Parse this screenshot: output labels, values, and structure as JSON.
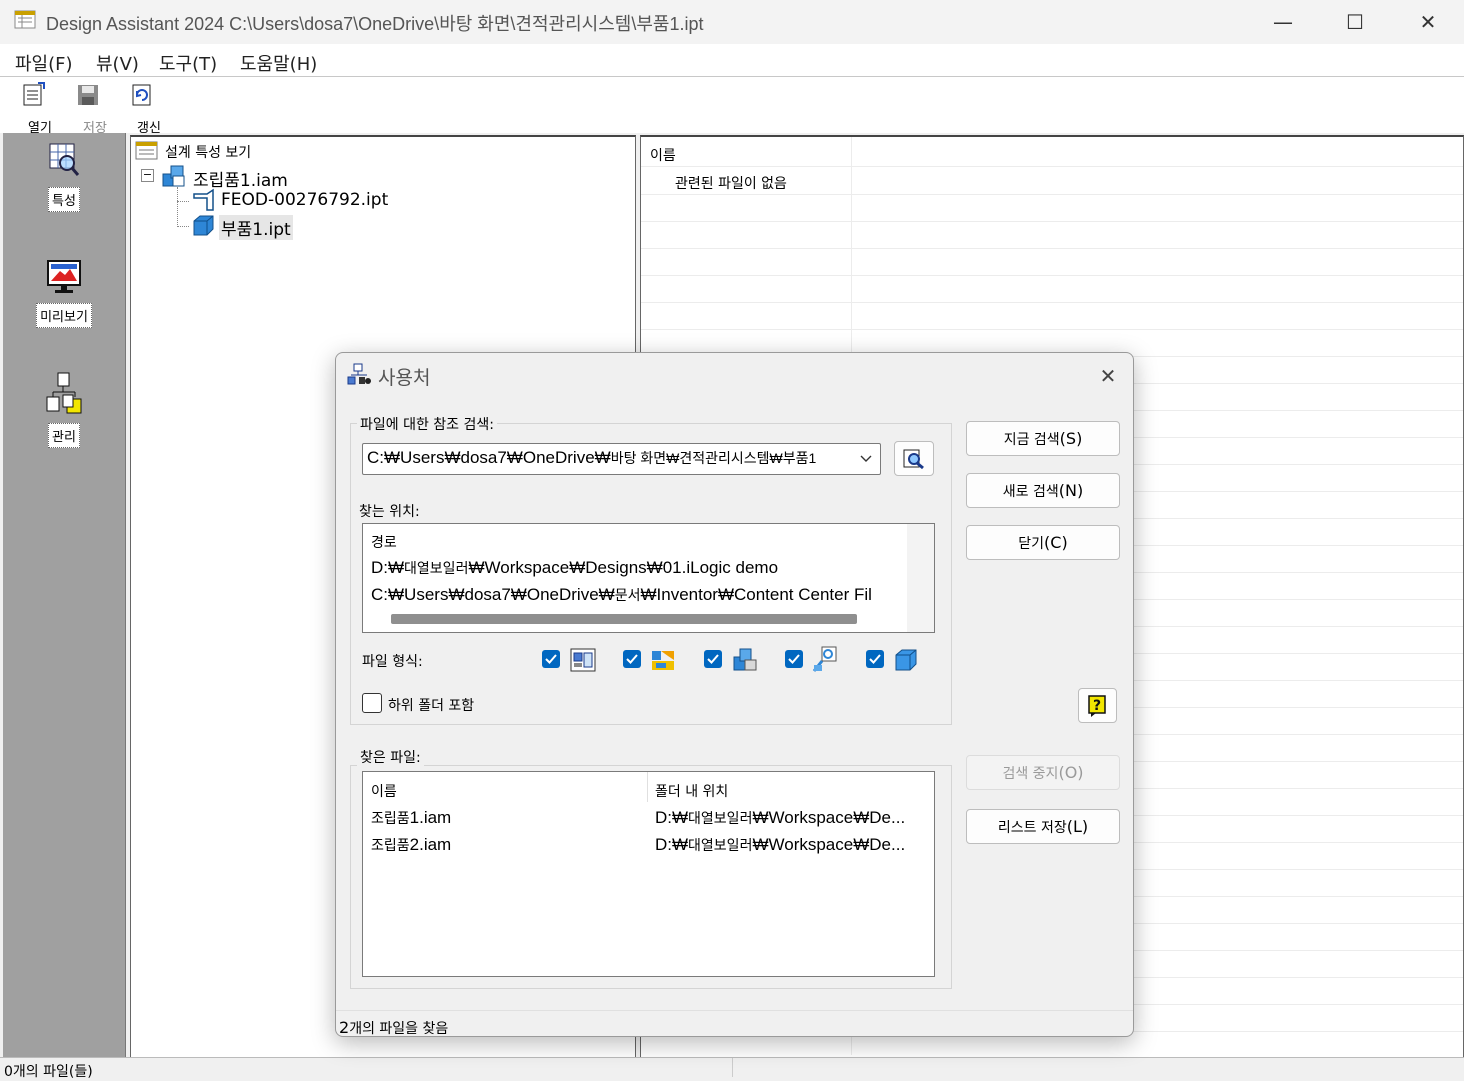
{
  "window": {
    "title": "Design Assistant 2024 C:\\Users\\dosa7\\OneDrive\\바탕 화면\\견적관리시스템\\부품1.ipt",
    "minimize_glyph": "—",
    "maximize_glyph": "☐",
    "close_glyph": "✕"
  },
  "menu": [
    {
      "label": "파일(F)"
    },
    {
      "label": "뷰(V)"
    },
    {
      "label": "도구(T)"
    },
    {
      "label": "도움말(H)"
    }
  ],
  "toolbar": {
    "open_label": "열기",
    "save_label": "저장",
    "refresh_label": "갱신"
  },
  "sidebar": {
    "items": [
      {
        "label": "특성",
        "icon": "properties-search-icon"
      },
      {
        "label": "미리보기",
        "icon": "preview-monitor-icon"
      },
      {
        "label": "관리",
        "icon": "manage-icon"
      }
    ]
  },
  "tree": {
    "root_label": "설계 특성 보기",
    "assembly_label": "조립품1.iam",
    "children": [
      {
        "label": "FEOD-00276792.ipt"
      },
      {
        "label": "부품1.ipt"
      }
    ],
    "collapse_glyph": "−"
  },
  "list_panel": {
    "header_name": "이름",
    "empty_message": "관련된 파일이 없음"
  },
  "status_bar": {
    "text": "0개의 파일(들)"
  },
  "dialog": {
    "title": "사용처",
    "close_glyph": "✕",
    "search_group_label": "파일에 대한 참조 검색:",
    "search_path_ascii_1": "C:₩Users₩dosa7₩OneDrive₩",
    "search_path_ko": "바탕 화면₩견적관리시스템₩부품1",
    "location_group_label": "찾는 위치:",
    "location_header": "경로",
    "location_1_prefix": "D:₩",
    "location_1_ko": "대열보일러",
    "location_1_suffix": "₩Workspace₩Designs₩01.iLogic demo",
    "location_2_prefix": "C:₩Users₩dosa7₩OneDrive₩",
    "location_2_ko": "문서",
    "location_2_suffix": "₩Inventor₩Content Center Fil",
    "file_type_label": "파일 형식:",
    "subfolder_label": "하위 폴더 포함",
    "found_group_label": "찾은 파일:",
    "found_col_name": "이름",
    "found_col_folder": "폴더 내 위치",
    "found_rows": [
      {
        "name_ko": "조립품",
        "name_rest": "1.iam",
        "folder_prefix": "D:₩",
        "folder_ko": "대열보일러",
        "folder_suffix": "₩Workspace₩De..."
      },
      {
        "name_ko": "조립품",
        "name_rest": "2.iam",
        "folder_prefix": "D:₩",
        "folder_ko": "대열보일러",
        "folder_suffix": "₩Workspace₩De..."
      }
    ],
    "buttons": {
      "search_now_ko": "지금 검색",
      "search_now_key": "(S)",
      "new_search_ko": "새로 검색",
      "new_search_key": "(N)",
      "close_ko": "닫기",
      "close_key": "(C)",
      "stop_search_ko": "검색 중지",
      "stop_search_key": "(O)",
      "save_list_ko": "리스트 저장",
      "save_list_key": "(L)"
    },
    "status_num": "2",
    "status_text": "개의 파일을 찾음",
    "accent_color": "#0067c0"
  }
}
